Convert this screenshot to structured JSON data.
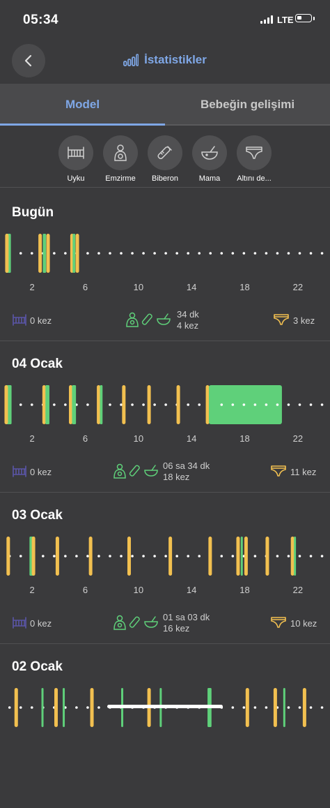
{
  "status": {
    "time": "05:34",
    "network": "LTE"
  },
  "header": {
    "title": "İstatistikler"
  },
  "tabs": [
    {
      "label": "Model",
      "active": true
    },
    {
      "label": "Bebeğin gelişimi",
      "active": false
    }
  ],
  "filters": [
    {
      "label": "Uyku",
      "icon": "crib-icon"
    },
    {
      "label": "Emzirme",
      "icon": "breastfeeding-icon"
    },
    {
      "label": "Biberon",
      "icon": "bottle-icon"
    },
    {
      "label": "Mama",
      "icon": "bowl-icon"
    },
    {
      "label": "Altını de...",
      "icon": "diaper-icon"
    }
  ],
  "colors": {
    "feeding": "#f2c050",
    "sleep": "#5fd07a",
    "accent": "#7fa7e6",
    "sleep_icon": "#5a55a8",
    "feed_icon": "#5fd07a",
    "diaper_icon": "#f2c050"
  },
  "axis_ticks": [
    "2",
    "6",
    "10",
    "14",
    "18",
    "22"
  ],
  "days": [
    {
      "title": "Bugün",
      "sleep_count": "0 kez",
      "feed_duration": "34 dk",
      "feed_count": "4 kez",
      "diaper_count": "3 kez",
      "marks": [
        {
          "type": "sleep",
          "start": 0.0,
          "end": 0.4
        },
        {
          "type": "feed",
          "hour": 0.1
        },
        {
          "type": "feed",
          "hour": 2.6
        },
        {
          "type": "sleep",
          "start": 2.8,
          "end": 3.05
        },
        {
          "type": "feed",
          "hour": 3.2
        },
        {
          "type": "feed",
          "hour": 5.0
        },
        {
          "type": "sleep",
          "start": 5.05,
          "end": 5.25
        },
        {
          "type": "feed",
          "hour": 5.4
        }
      ]
    },
    {
      "title": "04 Ocak",
      "sleep_count": "0 kez",
      "feed_duration": "06 sa 34 dk",
      "feed_count": "18 kez",
      "diaper_count": "11 kez",
      "marks": [
        {
          "type": "sleep",
          "start": 0.0,
          "end": 0.45
        },
        {
          "type": "feed",
          "hour": 0.05
        },
        {
          "type": "feed",
          "hour": 2.9
        },
        {
          "type": "sleep",
          "start": 3.0,
          "end": 3.3
        },
        {
          "type": "feed",
          "hour": 4.9
        },
        {
          "type": "sleep",
          "start": 5.0,
          "end": 5.3
        },
        {
          "type": "feed",
          "hour": 7.0
        },
        {
          "type": "sleep",
          "start": 7.1,
          "end": 7.3
        },
        {
          "type": "feed",
          "hour": 8.9
        },
        {
          "type": "feed",
          "hour": 10.8
        },
        {
          "type": "feed",
          "hour": 13.0
        },
        {
          "type": "feed",
          "hour": 15.2
        },
        {
          "type": "sleep",
          "start": 15.3,
          "end": 20.8
        }
      ]
    },
    {
      "title": "03 Ocak",
      "sleep_count": "0 kez",
      "feed_duration": "01 sa 03 dk",
      "feed_count": "16 kez",
      "diaper_count": "10 kez",
      "marks": [
        {
          "type": "feed",
          "hour": 0.2
        },
        {
          "type": "sleep",
          "start": 1.8,
          "end": 2.2
        },
        {
          "type": "feed",
          "hour": 2.1
        },
        {
          "type": "feed",
          "hour": 3.9
        },
        {
          "type": "feed",
          "hour": 6.4
        },
        {
          "type": "feed",
          "hour": 9.3
        },
        {
          "type": "feed",
          "hour": 12.4
        },
        {
          "type": "feed",
          "hour": 15.4
        },
        {
          "type": "feed",
          "hour": 17.5
        },
        {
          "type": "sleep",
          "start": 17.7,
          "end": 17.8
        },
        {
          "type": "feed",
          "hour": 18.1
        },
        {
          "type": "feed",
          "hour": 19.7
        },
        {
          "type": "feed",
          "hour": 21.6
        },
        {
          "type": "sleep",
          "start": 21.7,
          "end": 21.8
        }
      ]
    },
    {
      "title": "02 Ocak",
      "marks": [
        {
          "type": "feed",
          "hour": 0.8
        },
        {
          "type": "sleep",
          "start": 2.7,
          "end": 2.8
        },
        {
          "type": "feed",
          "hour": 3.8
        },
        {
          "type": "sleep",
          "start": 4.3,
          "end": 4.4
        },
        {
          "type": "feed",
          "hour": 6.5
        },
        {
          "type": "sleep",
          "start": 8.7,
          "end": 8.8
        },
        {
          "type": "feed",
          "hour": 10.8
        },
        {
          "type": "sleep",
          "start": 11.6,
          "end": 11.7
        },
        {
          "type": "sleep",
          "start": 15.2,
          "end": 15.5
        },
        {
          "type": "feed",
          "hour": 18.2
        },
        {
          "type": "feed",
          "hour": 20.3
        },
        {
          "type": "sleep",
          "start": 20.9,
          "end": 21.0
        },
        {
          "type": "feed",
          "hour": 22.5
        }
      ]
    }
  ]
}
